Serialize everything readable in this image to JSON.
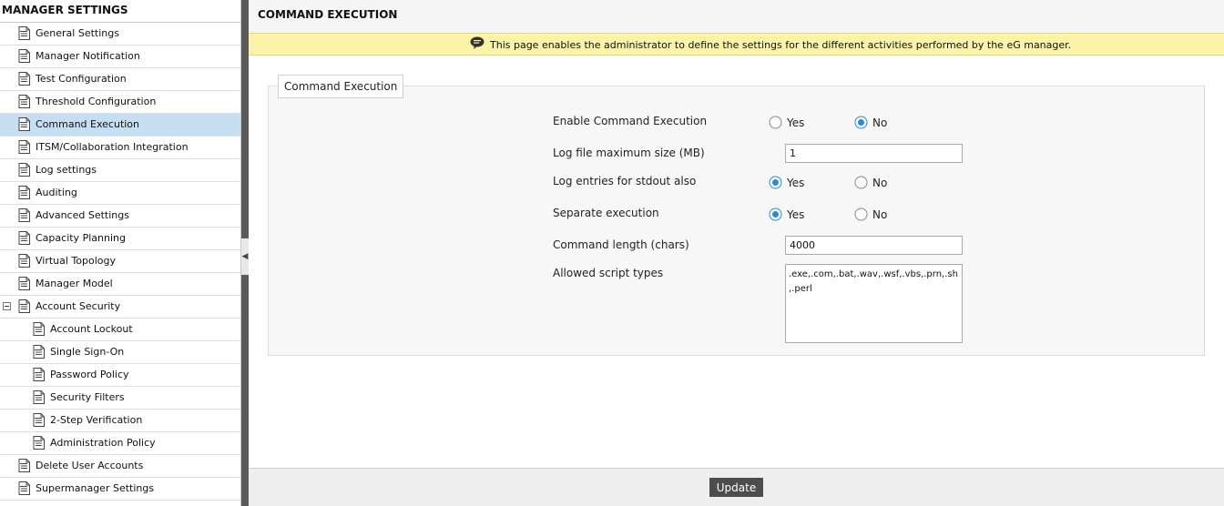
{
  "sidebar": {
    "title": "MANAGER SETTINGS",
    "items": [
      {
        "label": "General Settings",
        "level": 0
      },
      {
        "label": "Manager Notification",
        "level": 0
      },
      {
        "label": "Test Configuration",
        "level": 0
      },
      {
        "label": "Threshold Configuration",
        "level": 0
      },
      {
        "label": "Command Execution",
        "level": 0,
        "selected": true
      },
      {
        "label": "ITSM/Collaboration Integration",
        "level": 0
      },
      {
        "label": "Log settings",
        "level": 0
      },
      {
        "label": "Auditing",
        "level": 0
      },
      {
        "label": "Advanced Settings",
        "level": 0
      },
      {
        "label": "Capacity Planning",
        "level": 0
      },
      {
        "label": "Virtual Topology",
        "level": 0
      },
      {
        "label": "Manager Model",
        "level": 0
      },
      {
        "label": "Account Security",
        "level": 0,
        "expanded": true
      },
      {
        "label": "Account Lockout",
        "level": 1
      },
      {
        "label": "Single Sign-On",
        "level": 1
      },
      {
        "label": "Password Policy",
        "level": 1
      },
      {
        "label": "Security Filters",
        "level": 1
      },
      {
        "label": "2-Step Verification",
        "level": 1
      },
      {
        "label": "Administration Policy",
        "level": 1
      },
      {
        "label": "Delete User Accounts",
        "level": 0
      },
      {
        "label": "Supermanager Settings",
        "level": 0
      }
    ]
  },
  "page": {
    "title": "COMMAND EXECUTION",
    "info_text": "This page enables the administrator to define the settings for the different activities performed by the eG manager.",
    "section_title": "Command Execution"
  },
  "form": {
    "enable_command_execution": {
      "label": "Enable Command Execution",
      "yes": "Yes",
      "no": "No",
      "selected": "No"
    },
    "log_file_max_size": {
      "label": "Log file maximum size (MB)",
      "value": "1"
    },
    "log_entries_stdout": {
      "label": "Log entries for stdout also",
      "yes": "Yes",
      "no": "No",
      "selected": "Yes"
    },
    "separate_execution": {
      "label": "Separate execution",
      "yes": "Yes",
      "no": "No",
      "selected": "Yes"
    },
    "command_length": {
      "label": "Command length (chars)",
      "value": "4000"
    },
    "allowed_script_types": {
      "label": "Allowed script types",
      "value": ".exe,.com,.bat,.wav,.wsf,.vbs,.prn,.sh,.perl"
    }
  },
  "footer": {
    "update_label": "Update"
  },
  "colors": {
    "selected_bg": "#c6def2",
    "info_bar_bg": "#fbf3a8",
    "radio_accent": "#2a8ad4",
    "button_bg": "#4d4d4d"
  },
  "icons": {
    "nav_item": "document-list-icon",
    "info": "speech-bubble-icon",
    "collapse": "chevron-left-icon"
  }
}
